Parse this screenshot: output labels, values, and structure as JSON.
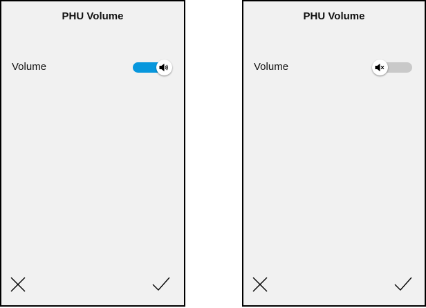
{
  "screens": [
    {
      "title": "PHU Volume",
      "setting_label": "Volume",
      "toggle_state": "on",
      "toggle_icon": "speaker-on-icon",
      "accent_color": "#0797dd",
      "cancel_icon": "close-icon",
      "confirm_icon": "checkmark-icon"
    },
    {
      "title": "PHU Volume",
      "setting_label": "Volume",
      "toggle_state": "off",
      "toggle_icon": "speaker-muted-icon",
      "track_color": "#c9c9c9",
      "cancel_icon": "close-icon",
      "confirm_icon": "checkmark-icon"
    }
  ]
}
